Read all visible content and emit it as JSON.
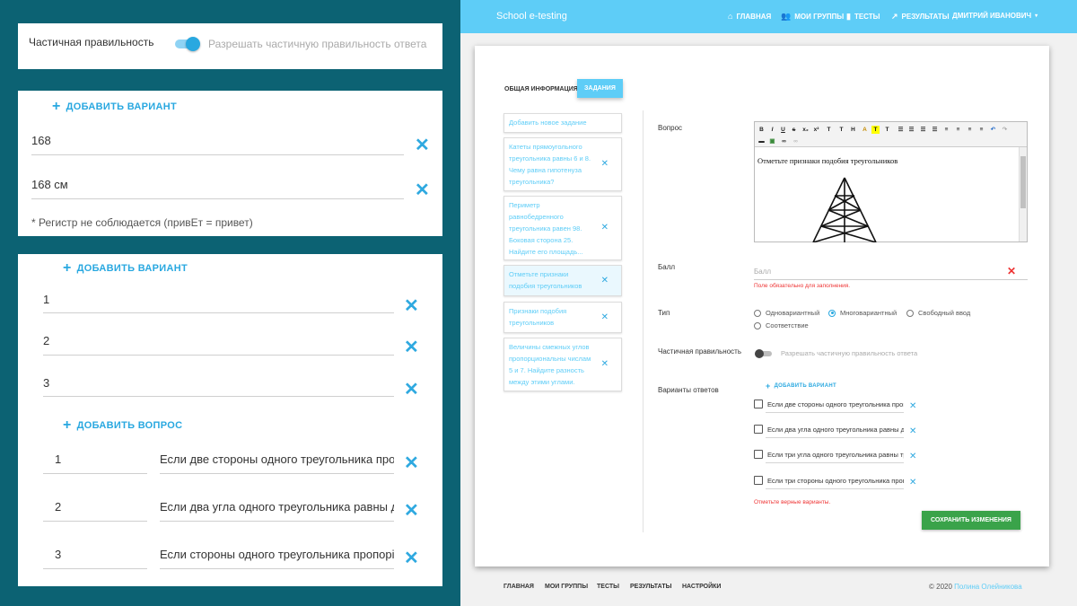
{
  "zoom_panels": {
    "partial": {
      "label": "Частичная правильность",
      "hint": "Разрешать частичную правильность ответа",
      "enabled": true
    },
    "text_answers": {
      "add_label": "ДОБАВИТЬ ВАРИАНТ",
      "answers": [
        "168",
        "168 см"
      ],
      "note": "* Регистр не соблюдается (привЕт = привет)"
    },
    "matching": {
      "add_variant_label": "ДОБАВИТЬ ВАРИАНТ",
      "variants": [
        "1",
        "2",
        "3"
      ],
      "add_question_label": "ДОБАВИТЬ ВОПРОС",
      "questions": [
        {
          "num": "1",
          "text": "Если две стороны одного треугольника про"
        },
        {
          "num": "2",
          "text": "Если два угла одного треугольника равны д"
        },
        {
          "num": "3",
          "text": "Если стороны одного треугольника пропорі"
        }
      ]
    }
  },
  "nav": {
    "brand": "School e-testing",
    "items": [
      {
        "label": "ГЛАВНАЯ",
        "icon": "home-icon"
      },
      {
        "label": "МОИ ГРУППЫ",
        "icon": "group-icon"
      },
      {
        "label": "ТЕСТЫ",
        "icon": "book-icon"
      },
      {
        "label": "РЕЗУЛЬТАТЫ",
        "icon": "chart-icon"
      }
    ],
    "user": "ДМИТРИЙ ИВАНОВИЧ"
  },
  "tabs": {
    "info": "ОБЩАЯ ИНФОРМАЦИЯ",
    "tasks": "ЗАДАНИЯ"
  },
  "tasks": {
    "add": "Добавить новое задание",
    "items": [
      "Катеты прямоугольного треугольника равны 6 и 8. Чему равна гипотенуза треугольника?",
      "Периметр равнобедренного треугольника равен 98. Боковая сторона 25. Найдите его площадь...",
      "Отметьте признаки подобия треугольников",
      "Признаки подобия треугольников",
      "Величины смежных углов пропорциональны числам 5 и 7. Найдите разность между этими углами."
    ]
  },
  "form": {
    "question_label": "Вопрос",
    "question_text": "Отметьте признаки подобия треугольников",
    "score_label": "Балл",
    "score_placeholder": "Балл",
    "score_error": "Поле обязательно для заполнения.",
    "type_label": "Тип",
    "types": [
      "Одновариантный",
      "Многовариантный",
      "Свободный ввод",
      "Соответствие"
    ],
    "selected_type": "Многовариантный",
    "partial_label": "Частичная правильность",
    "partial_hint": "Разрешать частичную правильность ответа",
    "variants_label": "Варианты ответов",
    "add_variant": "ДОБАВИТЬ ВАРИАНТ",
    "options": [
      "Если две стороны одного треугольника пропорциональны",
      "Если два угла одного треугольника равны двум углам",
      "Если три угла одного треугольника равны трём углам",
      "Если три стороны одного треугольника пропорциональны"
    ],
    "options_error": "Отметьте верные варианты.",
    "save": "СОХРАНИТЬ ИЗМЕНЕНИЯ"
  },
  "footer": {
    "links": [
      "ГЛАВНАЯ",
      "МОИ ГРУППЫ",
      "ТЕСТЫ",
      "РЕЗУЛЬТАТЫ",
      "НАСТРОЙКИ"
    ],
    "copyright": "© 2020",
    "author": "Полина Олейникова"
  }
}
